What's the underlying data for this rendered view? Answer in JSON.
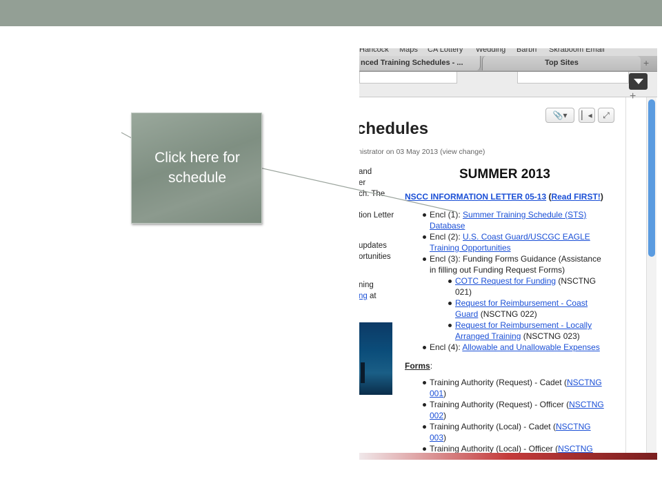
{
  "callout": {
    "text_line1": "Click here for",
    "text_line2": "schedule"
  },
  "bookmarks": [
    "Hancock",
    "Maps",
    "CA Lottery",
    "Wedding",
    "Barbri",
    "Skraboom Email"
  ],
  "tabs": [
    {
      "label": "nced Training Schedules - ..."
    },
    {
      "label": "Top Sites"
    }
  ],
  "page": {
    "title_fragment": "chedules",
    "meta_fragment": "nistrator on 03 May 2013  (view change)",
    "left_fragments": [
      "and",
      "er",
      "ch. The",
      "tion Letter",
      "updates",
      "ortunities",
      "ning",
      "ng",
      " at"
    ],
    "heading": "SUMMER 2013",
    "letter_link": "NSCC INFORMATION LETTER 05-13",
    "read_first": "Read FIRST!",
    "encl1_prefix": "Encl (1): ",
    "encl1_link_a": "Summer Training Schedule (STS)",
    "encl1_link_b": "Database",
    "encl2_prefix": "Encl (2): ",
    "encl2_link_a": "U.S. Coast Guard/USCGC EAGLE",
    "encl2_link_b": "Training Opportunities",
    "encl3_a": "Encl (3): Funding Forms Guidance (Assistance",
    "encl3_b": "in filling out Funding Request Forms)",
    "sub1_link": "COTC Request for Funding",
    "sub1_rest_a": " (NSCTNG",
    "sub1_rest_b": "021)",
    "sub2_link_a": "Request for Reimbursement - Coast",
    "sub2_link_b": "Guard",
    "sub2_rest": " (NSCTNG 022)",
    "sub3_link_a": "Request for Reimbursement - Locally",
    "sub3_link_b": "Arranged Training",
    "sub3_rest": " (NSCTNG 023)",
    "encl4_prefix": "Encl (4): ",
    "encl4_link": "Allowable and Unallowable Expenses",
    "forms_label": "Forms",
    "forms_colon": ":",
    "form1_text": "Training Authority (Request) - Cadet (",
    "form1_link_a": "NSCTNG",
    "form1_link_b": "001",
    "form2_text": "Training Authority (Request) - Officer (",
    "form2_link_a": "NSCTNG",
    "form2_link_b": "002",
    "form3_text": "Training Authority (Local) - Cadet (",
    "form3_link_a": "NSCTNG",
    "form3_link_b": "003",
    "form4_text": "Training Authority (Local) - Officer (",
    "form4_link_a": "NSCTNG",
    "close_paren": ")",
    "open_paren": "(",
    "close_paren_bang": ")"
  },
  "icons": {
    "attach": "paperclip-icon",
    "first": "skip-back-icon",
    "expand": "expand-icon"
  },
  "colors": {
    "header_bar": "#939f95",
    "callout_bg": "#8c9a8e",
    "link": "#1a4fd6",
    "scroll_thumb": "#5a9be0"
  }
}
